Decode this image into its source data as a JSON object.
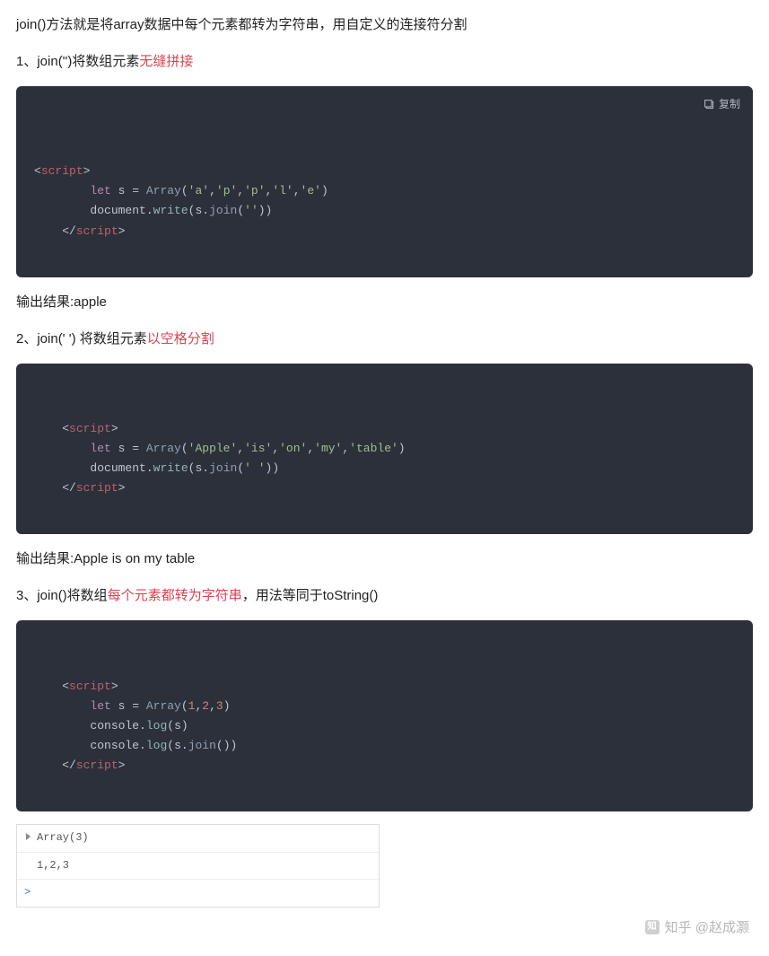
{
  "intro": "join()方法就是将array数据中每个元素都转为字符串，用自定义的连接符分割",
  "sec1": {
    "prefix": "1、join('')将数组元素",
    "highlight": "无缝拼接",
    "code_tokens": [
      [
        "t-punc",
        "<"
      ],
      [
        "t-tag",
        "script"
      ],
      [
        "t-punc",
        ">"
      ],
      [
        "nl",
        ""
      ],
      [
        "indent2",
        ""
      ],
      [
        "t-key",
        "let"
      ],
      [
        "t-var",
        " s "
      ],
      [
        "t-punc",
        "= "
      ],
      [
        "t-func",
        "Array"
      ],
      [
        "t-punc",
        "("
      ],
      [
        "t-str",
        "'a'"
      ],
      [
        "t-punc",
        ","
      ],
      [
        "t-str",
        "'p'"
      ],
      [
        "t-punc",
        ","
      ],
      [
        "t-str",
        "'p'"
      ],
      [
        "t-punc",
        ","
      ],
      [
        "t-str",
        "'l'"
      ],
      [
        "t-punc",
        ","
      ],
      [
        "t-str",
        "'e'"
      ],
      [
        "t-punc",
        ")"
      ],
      [
        "nl",
        ""
      ],
      [
        "indent2",
        ""
      ],
      [
        "t-obj",
        "document"
      ],
      [
        "t-punc",
        "."
      ],
      [
        "t-meth",
        "write"
      ],
      [
        "t-punc",
        "("
      ],
      [
        "t-var",
        "s"
      ],
      [
        "t-punc",
        "."
      ],
      [
        "t-call",
        "join"
      ],
      [
        "t-punc",
        "("
      ],
      [
        "t-str",
        "''"
      ],
      [
        "t-punc",
        "))"
      ],
      [
        "nl",
        ""
      ],
      [
        "indent1",
        ""
      ],
      [
        "t-punc",
        "</"
      ],
      [
        "t-tag",
        "script"
      ],
      [
        "t-punc",
        ">"
      ]
    ],
    "output": "输出结果:apple"
  },
  "sec2": {
    "prefix": "2、join(' ') 将数组元素",
    "highlight": "以空格分割",
    "code_tokens": [
      [
        "indent1",
        ""
      ],
      [
        "t-punc",
        "<"
      ],
      [
        "t-tag",
        "script"
      ],
      [
        "t-punc",
        ">"
      ],
      [
        "nl",
        ""
      ],
      [
        "indent2",
        ""
      ],
      [
        "t-key",
        "let"
      ],
      [
        "t-var",
        " s "
      ],
      [
        "t-punc",
        "= "
      ],
      [
        "t-func",
        "Array"
      ],
      [
        "t-punc",
        "("
      ],
      [
        "t-str",
        "'Apple'"
      ],
      [
        "t-punc",
        ","
      ],
      [
        "t-str",
        "'is'"
      ],
      [
        "t-punc",
        ","
      ],
      [
        "t-str",
        "'on'"
      ],
      [
        "t-punc",
        ","
      ],
      [
        "t-str",
        "'my'"
      ],
      [
        "t-punc",
        ","
      ],
      [
        "t-str",
        "'table'"
      ],
      [
        "t-punc",
        ")"
      ],
      [
        "nl",
        ""
      ],
      [
        "indent2",
        ""
      ],
      [
        "t-obj",
        "document"
      ],
      [
        "t-punc",
        "."
      ],
      [
        "t-meth",
        "write"
      ],
      [
        "t-punc",
        "("
      ],
      [
        "t-var",
        "s"
      ],
      [
        "t-punc",
        "."
      ],
      [
        "t-call",
        "join"
      ],
      [
        "t-punc",
        "("
      ],
      [
        "t-str",
        "' '"
      ],
      [
        "t-punc",
        "))"
      ],
      [
        "nl",
        ""
      ],
      [
        "indent1",
        ""
      ],
      [
        "t-punc",
        "</"
      ],
      [
        "t-tag",
        "script"
      ],
      [
        "t-punc",
        ">"
      ]
    ],
    "output": "输出结果:Apple is on my table"
  },
  "sec3": {
    "prefix": "3、join()将数组",
    "highlight": "每个元素都转为字符串",
    "suffix": "，用法等同于toString()",
    "code_tokens": [
      [
        "indent1",
        ""
      ],
      [
        "t-punc",
        "<"
      ],
      [
        "t-tag",
        "script"
      ],
      [
        "t-punc",
        ">"
      ],
      [
        "nl",
        ""
      ],
      [
        "indent2",
        ""
      ],
      [
        "t-key",
        "let"
      ],
      [
        "t-var",
        " s "
      ],
      [
        "t-punc",
        "= "
      ],
      [
        "t-func",
        "Array"
      ],
      [
        "t-punc",
        "("
      ],
      [
        "t-num",
        "1"
      ],
      [
        "t-punc",
        ","
      ],
      [
        "t-num",
        "2"
      ],
      [
        "t-punc",
        ","
      ],
      [
        "t-num",
        "3"
      ],
      [
        "t-punc",
        ")"
      ],
      [
        "nl",
        ""
      ],
      [
        "indent2",
        ""
      ],
      [
        "t-obj",
        "console"
      ],
      [
        "t-punc",
        "."
      ],
      [
        "t-meth",
        "log"
      ],
      [
        "t-punc",
        "("
      ],
      [
        "t-var",
        "s"
      ],
      [
        "t-punc",
        ")"
      ],
      [
        "nl",
        ""
      ],
      [
        "indent2",
        ""
      ],
      [
        "t-obj",
        "console"
      ],
      [
        "t-punc",
        "."
      ],
      [
        "t-meth",
        "log"
      ],
      [
        "t-punc",
        "("
      ],
      [
        "t-var",
        "s"
      ],
      [
        "t-punc",
        "."
      ],
      [
        "t-call",
        "join"
      ],
      [
        "t-punc",
        "())"
      ],
      [
        "nl",
        ""
      ],
      [
        "indent1",
        ""
      ],
      [
        "t-punc",
        "</"
      ],
      [
        "t-tag",
        "script"
      ],
      [
        "t-punc",
        ">"
      ]
    ],
    "console": {
      "line1": "Array(3)",
      "line2": "1,2,3",
      "prompt": ">"
    }
  },
  "copy_label": "复制",
  "watermark": "知乎 @赵成灏"
}
